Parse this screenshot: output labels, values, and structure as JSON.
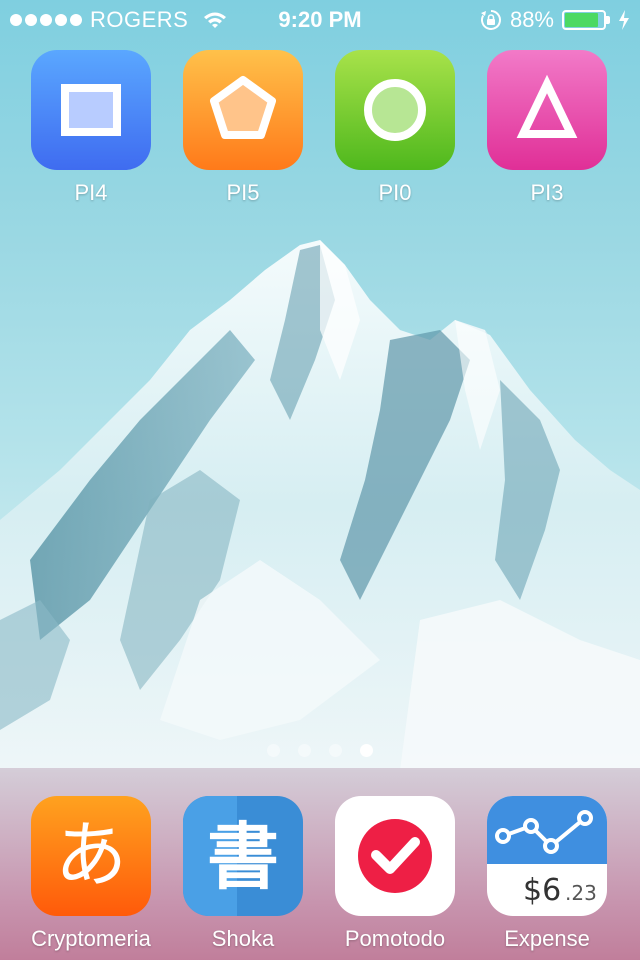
{
  "status_bar": {
    "carrier": "ROGERS",
    "time": "9:20 PM",
    "battery_percent": "88%",
    "battery_level": 0.88,
    "battery_color": "#4cd964"
  },
  "home_apps": [
    {
      "label": "PI4",
      "icon": "square-icon",
      "color": "#4f87f7"
    },
    {
      "label": "PI5",
      "icon": "pentagon-icon",
      "color": "#ff9a2e"
    },
    {
      "label": "PI0",
      "icon": "circle-icon",
      "color": "#7ccd33"
    },
    {
      "label": "PI3",
      "icon": "triangle-icon",
      "color": "#ea52ae"
    }
  ],
  "page_indicator": {
    "count": 4,
    "active_index": 3
  },
  "dock_apps": [
    {
      "label": "Cryptomeria",
      "icon": "hiragana-a-icon",
      "glyph": "あ"
    },
    {
      "label": "Shoka",
      "icon": "kanji-book-icon",
      "glyph": "書"
    },
    {
      "label": "Pomotodo",
      "icon": "checkmark-circle-icon"
    },
    {
      "label": "Expense",
      "icon": "line-graph-icon",
      "amount_main": "$6",
      "amount_cents": ".23"
    }
  ]
}
